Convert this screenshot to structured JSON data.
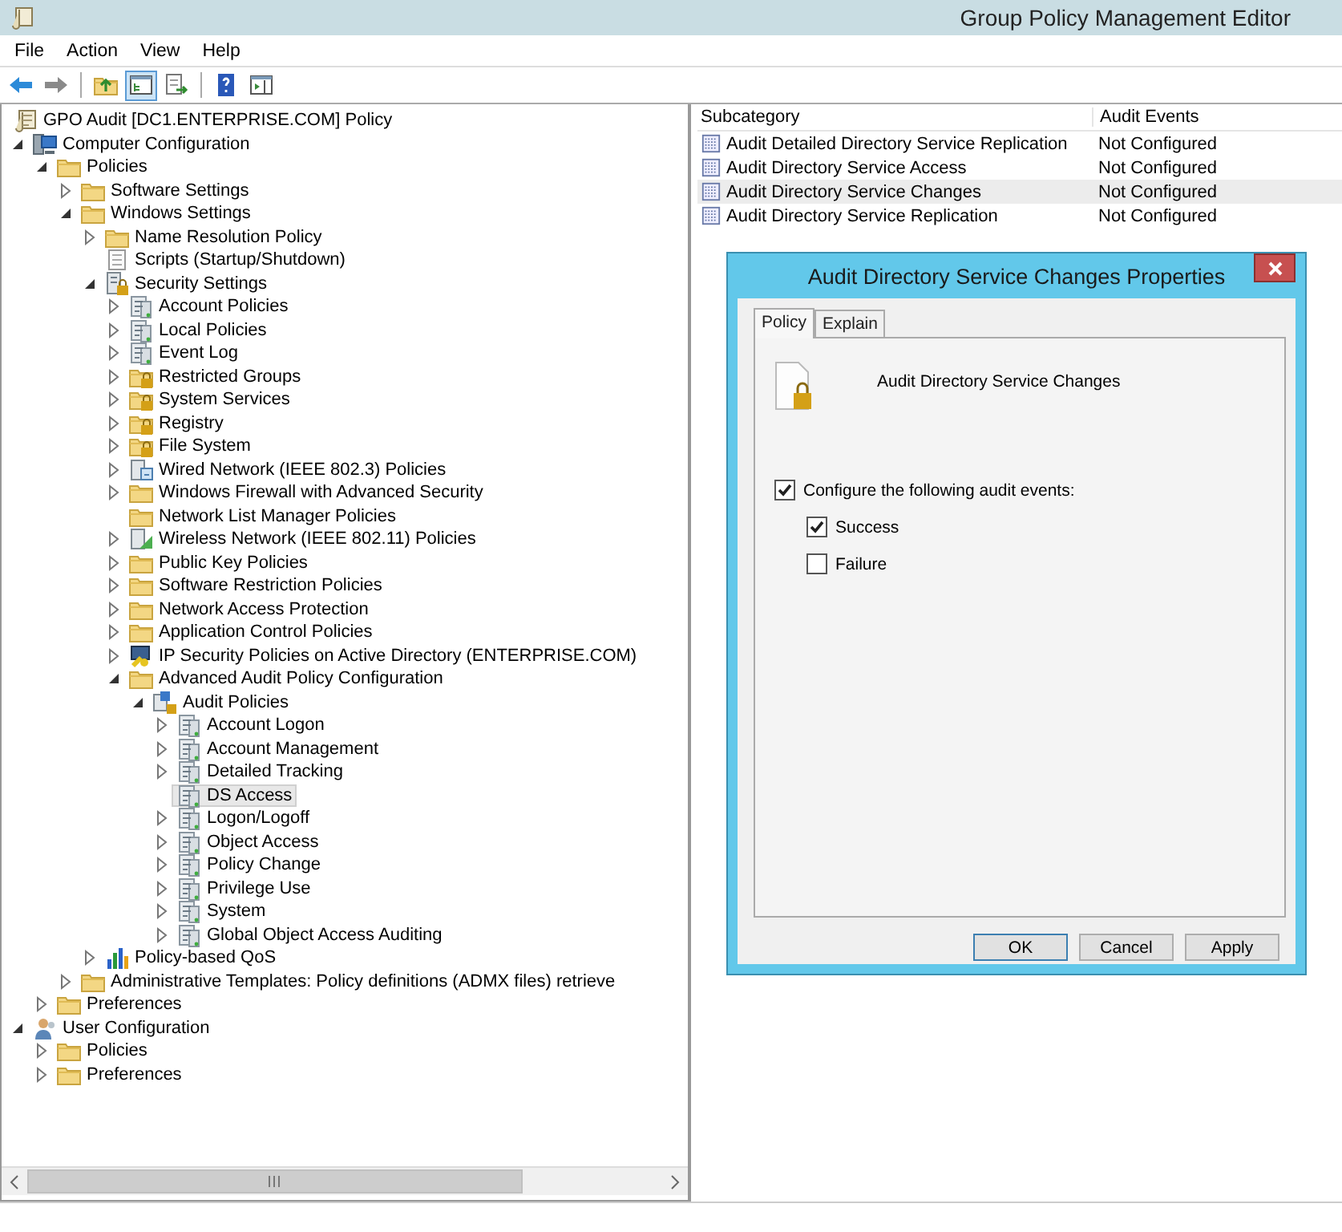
{
  "window": {
    "title": "Group Policy Management Editor"
  },
  "menu": [
    "File",
    "Action",
    "View",
    "Help"
  ],
  "toolbar": [
    {
      "kind": "back",
      "pressed": false
    },
    {
      "kind": "forward",
      "pressed": false
    },
    {
      "kind": "separator"
    },
    {
      "kind": "up",
      "pressed": false
    },
    {
      "kind": "tree",
      "pressed": true
    },
    {
      "kind": "export",
      "pressed": false
    },
    {
      "kind": "separator"
    },
    {
      "kind": "help",
      "pressed": false
    },
    {
      "kind": "pane",
      "pressed": false
    }
  ],
  "tree": [
    {
      "label": "GPO Audit [DC1.ENTERPRISE.COM] Policy",
      "kind": "scroll",
      "selected": false,
      "children": [
        {
          "label": "Computer Configuration",
          "kind": "computer",
          "expanded": true,
          "selected": false,
          "children": [
            {
              "label": "Policies",
              "kind": "folder",
              "expanded": true,
              "selected": false,
              "children": [
                {
                  "label": "Software Settings",
                  "kind": "folder",
                  "expanded": false,
                  "selected": false
                },
                {
                  "label": "Windows Settings",
                  "kind": "folder",
                  "expanded": true,
                  "selected": false,
                  "children": [
                    {
                      "label": "Name Resolution Policy",
                      "kind": "folder",
                      "expanded": false,
                      "selected": false
                    },
                    {
                      "label": "Scripts (Startup/Shutdown)",
                      "kind": "script",
                      "selected": false
                    },
                    {
                      "label": "Security Settings",
                      "kind": "secure",
                      "expanded": true,
                      "selected": false,
                      "children": [
                        {
                          "label": "Account Policies",
                          "kind": "policy",
                          "expanded": false,
                          "selected": false
                        },
                        {
                          "label": "Local Policies",
                          "kind": "policy",
                          "expanded": false,
                          "selected": false
                        },
                        {
                          "label": "Event Log",
                          "kind": "policy",
                          "expanded": false,
                          "selected": false
                        },
                        {
                          "label": "Restricted Groups",
                          "kind": "lockfolder",
                          "expanded": false,
                          "selected": false
                        },
                        {
                          "label": "System Services",
                          "kind": "lockfolder",
                          "expanded": false,
                          "selected": false
                        },
                        {
                          "label": "Registry",
                          "kind": "lockfolder",
                          "expanded": false,
                          "selected": false
                        },
                        {
                          "label": "File System",
                          "kind": "lockfolder",
                          "expanded": false,
                          "selected": false
                        },
                        {
                          "label": "Wired Network (IEEE 802.3) Policies",
                          "kind": "network",
                          "expanded": false,
                          "selected": false
                        },
                        {
                          "label": "Windows Firewall with Advanced Security",
                          "kind": "folder",
                          "expanded": false,
                          "selected": false
                        },
                        {
                          "label": "Network List Manager Policies",
                          "kind": "folder",
                          "selected": false
                        },
                        {
                          "label": "Wireless Network (IEEE 802.11) Policies",
                          "kind": "wireless",
                          "expanded": false,
                          "selected": false
                        },
                        {
                          "label": "Public Key Policies",
                          "kind": "folder",
                          "expanded": false,
                          "selected": false
                        },
                        {
                          "label": "Software Restriction Policies",
                          "kind": "folder",
                          "expanded": false,
                          "selected": false
                        },
                        {
                          "label": "Network Access Protection",
                          "kind": "folder",
                          "expanded": false,
                          "selected": false
                        },
                        {
                          "label": "Application Control Policies",
                          "kind": "folder",
                          "expanded": false,
                          "selected": false
                        },
                        {
                          "label": "IP Security Policies on Active Directory (ENTERPRISE.COM)",
                          "kind": "ipsec",
                          "expanded": false,
                          "selected": false
                        },
                        {
                          "label": "Advanced Audit Policy Configuration",
                          "kind": "folder",
                          "expanded": true,
                          "selected": false,
                          "children": [
                            {
                              "label": "Audit Policies",
                              "kind": "audit",
                              "expanded": true,
                              "selected": false,
                              "children": [
                                {
                                  "label": "Account Logon",
                                  "kind": "policy",
                                  "expanded": false,
                                  "selected": false
                                },
                                {
                                  "label": "Account Management",
                                  "kind": "policy",
                                  "expanded": false,
                                  "selected": false
                                },
                                {
                                  "label": "Detailed Tracking",
                                  "kind": "policy",
                                  "expanded": false,
                                  "selected": false
                                },
                                {
                                  "label": "DS Access",
                                  "kind": "policy",
                                  "selected": true
                                },
                                {
                                  "label": "Logon/Logoff",
                                  "kind": "policy",
                                  "expanded": false,
                                  "selected": false
                                },
                                {
                                  "label": "Object Access",
                                  "kind": "policy",
                                  "expanded": false,
                                  "selected": false
                                },
                                {
                                  "label": "Policy Change",
                                  "kind": "policy",
                                  "expanded": false,
                                  "selected": false
                                },
                                {
                                  "label": "Privilege Use",
                                  "kind": "policy",
                                  "expanded": false,
                                  "selected": false
                                },
                                {
                                  "label": "System",
                                  "kind": "policy",
                                  "expanded": false,
                                  "selected": false
                                },
                                {
                                  "label": "Global Object Access Auditing",
                                  "kind": "policy",
                                  "expanded": false,
                                  "selected": false
                                }
                              ]
                            }
                          ]
                        }
                      ]
                    },
                    {
                      "label": "Policy-based QoS",
                      "kind": "qos",
                      "expanded": false,
                      "selected": false
                    }
                  ]
                },
                {
                  "label": "Administrative Templates: Policy definitions (ADMX files) retrieve",
                  "kind": "folder",
                  "expanded": false,
                  "selected": false
                }
              ]
            },
            {
              "label": "Preferences",
              "kind": "folder",
              "expanded": false,
              "selected": false
            }
          ]
        },
        {
          "label": "User Configuration",
          "kind": "user",
          "expanded": true,
          "selected": false,
          "children": [
            {
              "label": "Policies",
              "kind": "folder",
              "expanded": false,
              "selected": false
            },
            {
              "label": "Preferences",
              "kind": "folder",
              "expanded": false,
              "selected": false
            }
          ]
        }
      ]
    }
  ],
  "list": {
    "columns": [
      "Subcategory",
      "Audit Events"
    ],
    "rows": [
      {
        "name": "Audit Detailed Directory Service Replication",
        "events": "Not Configured",
        "selected": false
      },
      {
        "name": "Audit Directory Service Access",
        "events": "Not Configured",
        "selected": false
      },
      {
        "name": "Audit Directory Service Changes",
        "events": "Not Configured",
        "selected": true
      },
      {
        "name": "Audit Directory Service Replication",
        "events": "Not Configured",
        "selected": false
      }
    ]
  },
  "dialog": {
    "title": "Audit Directory Service Changes Properties",
    "tabs": [
      {
        "label": "Policy",
        "selected": true
      },
      {
        "label": "Explain",
        "selected": false
      }
    ],
    "policy_name": "Audit Directory Service Changes",
    "configure": {
      "label": "Configure the following audit events:",
      "checked": true
    },
    "options": [
      {
        "label": "Success",
        "checked": true
      },
      {
        "label": "Failure",
        "checked": false
      }
    ],
    "buttons": [
      {
        "label": "OK",
        "default": true
      },
      {
        "label": "Cancel",
        "default": false
      },
      {
        "label": "Apply",
        "default": false
      }
    ]
  }
}
